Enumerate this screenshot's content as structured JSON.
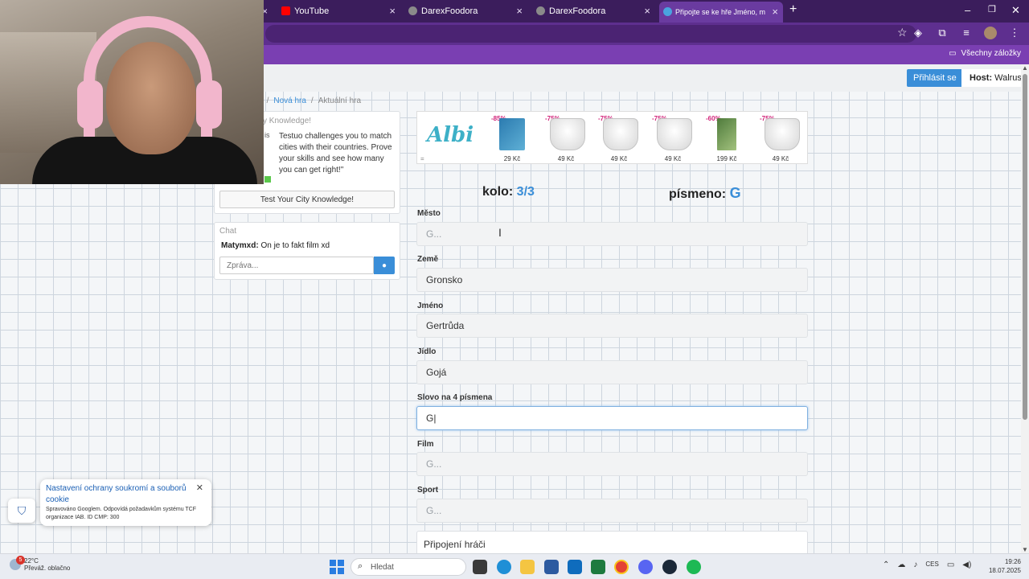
{
  "browser": {
    "tabs": [
      {
        "label": "YouTube",
        "icon": "youtube-icon",
        "color": "#ff0000"
      },
      {
        "label": "DarexFoodora",
        "icon": "globe-icon",
        "color": "#777777"
      },
      {
        "label": "DarexFoodora",
        "icon": "globe-icon",
        "color": "#777777"
      },
      {
        "label": "Připojte se ke hře Jméno, město",
        "icon": "game-icon",
        "color": "#4aa3df"
      }
    ],
    "all_bookmarks": "Všechny záložky"
  },
  "header": {
    "login_label": "Přihlásit se",
    "host_label": "Host:",
    "host_name": "Walrus"
  },
  "breadcrumb": {
    "prev": "a",
    "new_game": "Nová hra",
    "current": "Aktuální hra"
  },
  "promo": {
    "title": "y Knowledge!",
    "side_char": "is",
    "text": "Testuo challenges you to match cities with their countries. Prove your skills and see how many you can get right!\"",
    "button_label": "Test Your City Knowledge!"
  },
  "chat": {
    "title": "Chat",
    "messages": [
      {
        "user": "Matymxd:",
        "text": "On je to fakt film xd"
      }
    ],
    "input_placeholder": "Zpráva..."
  },
  "ad": {
    "brand": "Albi",
    "more": "=",
    "items": [
      {
        "badge": "-85%",
        "price": "29 Kč",
        "kind": "box"
      },
      {
        "badge": "-75%",
        "price": "49 Kč",
        "kind": "pot"
      },
      {
        "badge": "-75%",
        "price": "49 Kč",
        "kind": "pot"
      },
      {
        "badge": "-75%",
        "price": "49 Kč",
        "kind": "pot"
      },
      {
        "badge": "-60%",
        "price": "199 Kč",
        "kind": "book"
      },
      {
        "badge": "-75%",
        "price": "49 Kč",
        "kind": "pot"
      }
    ]
  },
  "game": {
    "round_label": "kolo:",
    "round_value": "3/3",
    "letter_label": "písmeno:",
    "letter_value": "G",
    "fields": [
      {
        "label": "Město",
        "value": "",
        "placeholder": "G..."
      },
      {
        "label": "Země",
        "value": "Gronsko",
        "placeholder": "G..."
      },
      {
        "label": "Jméno",
        "value": "Gertrůda",
        "placeholder": "G..."
      },
      {
        "label": "Jídlo",
        "value": "Gojá",
        "placeholder": "G..."
      },
      {
        "label": "Slovo na 4 písmena",
        "value": "G|",
        "placeholder": "G..."
      },
      {
        "label": "Film",
        "value": "",
        "placeholder": "G..."
      },
      {
        "label": "Sport",
        "value": "",
        "placeholder": "G..."
      }
    ],
    "players_label": "Připojení hráči"
  },
  "cookie": {
    "title": "Nastavení ochrany soukromí a souborů cookie",
    "text": "Spravováno Googlem. Odpovídá požadavkům systému TCF organizace IAB. ID CMP: 300"
  },
  "taskbar": {
    "temp": "22°C",
    "weather": "Převáž. oblačno",
    "weather_badge": "5",
    "search_placeholder": "Hledat",
    "lang": "CES",
    "time": "19:26",
    "date": "18.07.2025"
  },
  "colors": {
    "accent": "#3a8ed8",
    "browser_purple": "#5e2f8f"
  }
}
